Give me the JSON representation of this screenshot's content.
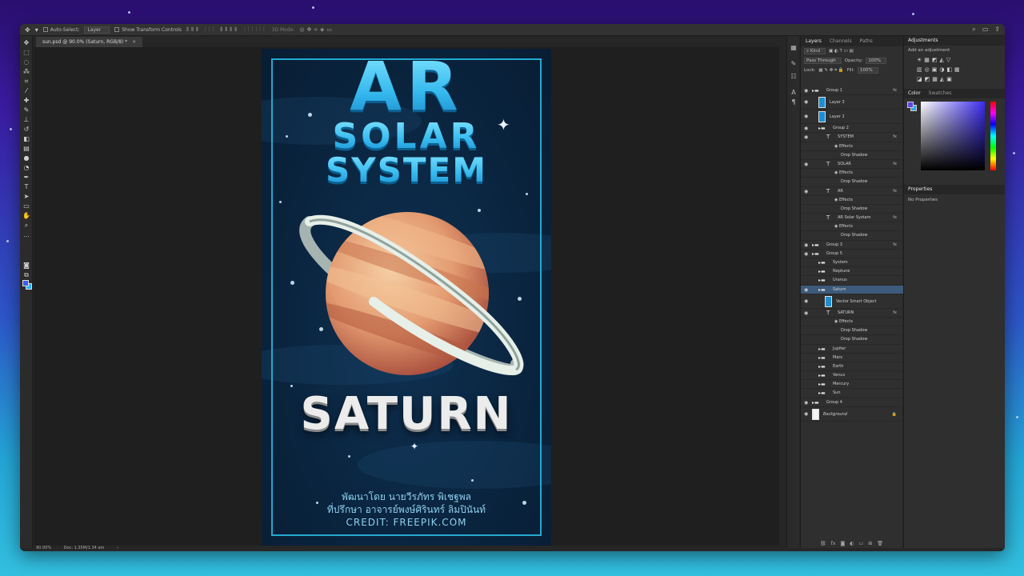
{
  "options_bar": {
    "auto_select_label": "Auto-Select:",
    "auto_select_value": "Layer",
    "transform_controls_label": "Show Transform Controls",
    "mode_3d_label": "3D Mode:"
  },
  "document_tab": {
    "title": "sun.psd @ 90.0% (Saturn, RGB/8) *",
    "close_glyph": "×"
  },
  "poster": {
    "title_ar": "AR",
    "title_solar": "SOLAR",
    "title_system": "SYSTEM",
    "planet_name": "SATURN",
    "credit_line1": "พัฒนาโดย นายวีรภัทร พิเชฐพล",
    "credit_line2": "ที่ปรึกษา อาจารย์พงษ์ศิรินทร์ ลิมปินันท์",
    "credit_line3": "CREDIT: FREEPIK.COM"
  },
  "status_bar": {
    "zoom": "90.00%",
    "doc_size": "Doc: 1.35M/1.34 am"
  },
  "layers_panel": {
    "tabs": [
      "Layers",
      "Channels",
      "Paths"
    ],
    "filter_label": "Kind",
    "blend_mode": "Pass Through",
    "opacity_label": "Opacity:",
    "opacity_value": "100%",
    "lock_label": "Lock:",
    "fill_label": "Fill:",
    "fill_value": "100%",
    "layers": [
      {
        "name": "Group 1",
        "type": "group",
        "indent": 0,
        "visible": true,
        "fx": true
      },
      {
        "name": "Layer 3",
        "type": "pixel",
        "indent": 1,
        "visible": true
      },
      {
        "name": "Layer 2",
        "type": "pixel",
        "indent": 1,
        "visible": true
      },
      {
        "name": "Group 2",
        "type": "group",
        "indent": 1,
        "visible": true
      },
      {
        "name": "SYSTEM",
        "type": "text",
        "indent": 2,
        "visible": true,
        "fx": true
      },
      {
        "name": "Effects",
        "type": "effect",
        "indent": 3
      },
      {
        "name": "Drop Shadow",
        "type": "effect",
        "indent": 4
      },
      {
        "name": "SOLAR",
        "type": "text",
        "indent": 2,
        "visible": true,
        "fx": true
      },
      {
        "name": "Effects",
        "type": "effect",
        "indent": 3
      },
      {
        "name": "Drop Shadow",
        "type": "effect",
        "indent": 4
      },
      {
        "name": "AR",
        "type": "text",
        "indent": 2,
        "visible": true,
        "fx": true
      },
      {
        "name": "Effects",
        "type": "effect",
        "indent": 3
      },
      {
        "name": "Drop Shadow",
        "type": "effect",
        "indent": 4
      },
      {
        "name": "AR Solar Systam",
        "type": "text",
        "indent": 2,
        "visible": false,
        "fx": true
      },
      {
        "name": "Effects",
        "type": "effect",
        "indent": 3
      },
      {
        "name": "Drop Shadow",
        "type": "effect",
        "indent": 4
      },
      {
        "name": "Group 3",
        "type": "group",
        "indent": 0,
        "visible": true,
        "fx": true
      },
      {
        "name": "Group 5",
        "type": "group",
        "indent": 0,
        "visible": true
      },
      {
        "name": "System",
        "type": "group",
        "indent": 1,
        "visible": false
      },
      {
        "name": "Neptune",
        "type": "group",
        "indent": 1,
        "visible": false
      },
      {
        "name": "Uranus",
        "type": "group",
        "indent": 1,
        "visible": false
      },
      {
        "name": "Saturn",
        "type": "group",
        "indent": 1,
        "visible": true,
        "selected": true
      },
      {
        "name": "Vector Smart Object",
        "type": "smart",
        "indent": 2,
        "visible": true
      },
      {
        "name": "SATURN",
        "type": "text",
        "indent": 2,
        "visible": true,
        "fx": true
      },
      {
        "name": "Effects",
        "type": "effect",
        "indent": 3
      },
      {
        "name": "Drop Shadow",
        "type": "effect",
        "indent": 4
      },
      {
        "name": "Drop Shadow",
        "type": "effect",
        "indent": 4
      },
      {
        "name": "Jupiter",
        "type": "group",
        "indent": 1,
        "visible": false
      },
      {
        "name": "Mars",
        "type": "group",
        "indent": 1,
        "visible": false
      },
      {
        "name": "Earth",
        "type": "group",
        "indent": 1,
        "visible": false
      },
      {
        "name": "Venus",
        "type": "group",
        "indent": 1,
        "visible": false
      },
      {
        "name": "Mercury",
        "type": "group",
        "indent": 1,
        "visible": false
      },
      {
        "name": "Sun",
        "type": "group",
        "indent": 1,
        "visible": false
      },
      {
        "name": "Group 4",
        "type": "group",
        "indent": 0,
        "visible": true
      },
      {
        "name": "Background",
        "type": "background",
        "indent": 0,
        "visible": true
      }
    ]
  },
  "adjustments_panel": {
    "tab": "Adjustments",
    "subtitle": "Add an adjustment"
  },
  "color_panel": {
    "tabs": [
      "Color",
      "Swatches"
    ],
    "foreground": "#5a49e6",
    "background": "#2aa7e8"
  },
  "properties_panel": {
    "tab": "Properties",
    "empty_text": "No Properties"
  }
}
